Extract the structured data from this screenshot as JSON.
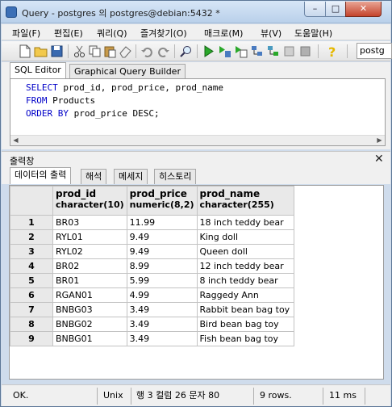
{
  "window": {
    "title": "Query - postgres 의 postgres@debian:5432 *",
    "controls": {
      "minimize": "–",
      "maximize": "□",
      "close": "✕"
    }
  },
  "menu": [
    "파일(F)",
    "편집(E)",
    "쿼리(Q)",
    "즐겨찾기(O)",
    "매크로(M)",
    "뷰(V)",
    "도움말(H)"
  ],
  "toolbar": {
    "icons": [
      "new-file-icon",
      "open-folder-icon",
      "save-icon",
      "cut-icon",
      "copy-icon",
      "paste-icon",
      "eraser-icon",
      "undo-icon",
      "redo-icon",
      "find-icon",
      "execute-icon",
      "execute-explain-icon",
      "execute-to-file-icon",
      "explain-icon",
      "stop-icon",
      "help-icon"
    ],
    "database": "postg"
  },
  "editor": {
    "tabs": [
      "SQL Editor",
      "Graphical Query Builder"
    ],
    "active_tab": "SQL Editor",
    "lines": [
      {
        "kw": "SELECT",
        "rest": " prod_id, prod_price, prod_name"
      },
      {
        "kw": "FROM",
        "rest": " Products"
      },
      {
        "kw": "ORDER BY",
        "rest": " prod_price DESC;"
      }
    ]
  },
  "output": {
    "title": "출력창",
    "close": "✕",
    "tabs": [
      "데이터의 출력",
      "해석",
      "메세지",
      "히스토리"
    ],
    "active_tab": "데이터의 출력",
    "columns": [
      {
        "name": "prod_id",
        "type": "character(10)"
      },
      {
        "name": "prod_price",
        "type": "numeric(8,2)"
      },
      {
        "name": "prod_name",
        "type": "character(255)"
      }
    ],
    "rows": [
      {
        "num": "1",
        "cells": [
          "BR03",
          "11.99",
          "18 inch teddy bear"
        ]
      },
      {
        "num": "2",
        "cells": [
          "RYL01",
          "9.49",
          "King doll"
        ]
      },
      {
        "num": "3",
        "cells": [
          "RYL02",
          "9.49",
          "Queen doll"
        ]
      },
      {
        "num": "4",
        "cells": [
          "BR02",
          "8.99",
          "12 inch teddy bear"
        ]
      },
      {
        "num": "5",
        "cells": [
          "BR01",
          "5.99",
          "8 inch teddy bear"
        ]
      },
      {
        "num": "6",
        "cells": [
          "RGAN01",
          "4.99",
          "Raggedy Ann"
        ]
      },
      {
        "num": "7",
        "cells": [
          "BNBG03",
          "3.49",
          "Rabbit bean bag toy"
        ]
      },
      {
        "num": "8",
        "cells": [
          "BNBG02",
          "3.49",
          "Bird bean bag toy"
        ]
      },
      {
        "num": "9",
        "cells": [
          "BNBG01",
          "3.49",
          "Fish bean bag toy"
        ]
      }
    ]
  },
  "status": {
    "state": "OK.",
    "encoding": "Unix",
    "position": "행 3 컬럼 26 문자 80",
    "rows": "9 rows.",
    "time": "11 ms"
  }
}
